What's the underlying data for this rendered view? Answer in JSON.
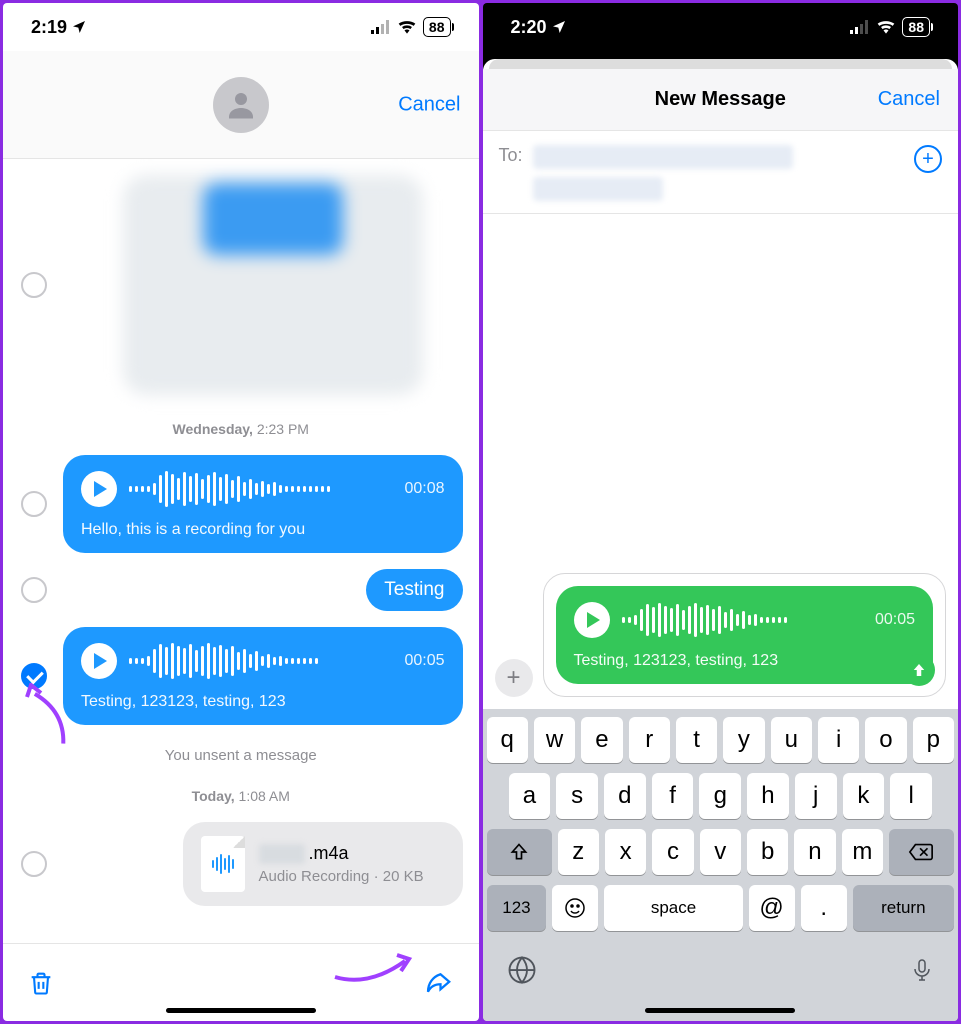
{
  "left": {
    "statusTime": "2:19",
    "battery": "88",
    "cancel": "Cancel",
    "timestamp1_day": "Wednesday,",
    "timestamp1_time": "2:23 PM",
    "audio1_duration": "00:08",
    "audio1_transcript": "Hello, this is a recording for you",
    "msg_testing": "Testing",
    "audio2_duration": "00:05",
    "audio2_transcript": "Testing, 123123, testing, 123",
    "unsent": "You unsent a message",
    "timestamp2_day": "Today,",
    "timestamp2_time": "1:08 AM",
    "file_ext": ".m4a",
    "file_sub": "Audio Recording · 20 KB"
  },
  "right": {
    "statusTime": "2:20",
    "battery": "88",
    "title": "New Message",
    "cancel": "Cancel",
    "to_label": "To:",
    "audio_duration": "00:05",
    "audio_transcript": "Testing, 123123, testing, 123",
    "keys_row1": [
      "q",
      "w",
      "e",
      "r",
      "t",
      "y",
      "u",
      "i",
      "o",
      "p"
    ],
    "keys_row2": [
      "a",
      "s",
      "d",
      "f",
      "g",
      "h",
      "j",
      "k",
      "l"
    ],
    "keys_row3": [
      "z",
      "x",
      "c",
      "v",
      "b",
      "n",
      "m"
    ],
    "key_space": "space",
    "key_at": "@",
    "key_dot": ".",
    "key_return": "return",
    "key_123": "123"
  }
}
